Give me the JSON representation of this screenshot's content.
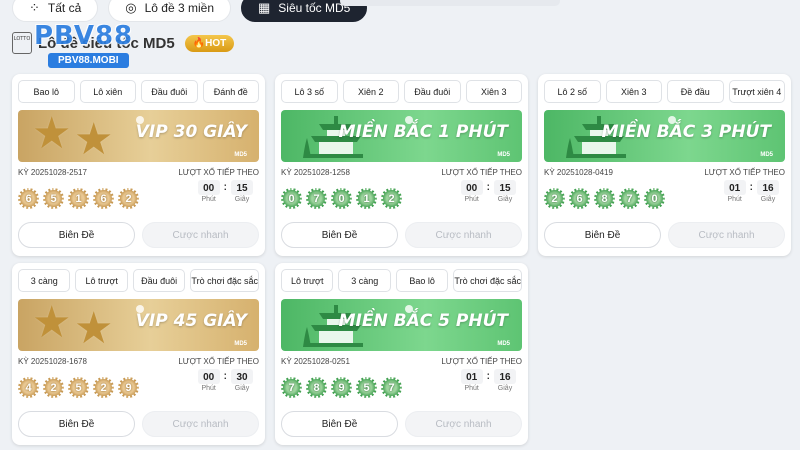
{
  "tabs": [
    {
      "label": "Tất cả",
      "icon": "grid-icon"
    },
    {
      "label": "Lô đề 3 miền",
      "icon": "lottery-ball-icon"
    },
    {
      "label": "Siêu tốc MD5",
      "icon": "calculator-icon"
    }
  ],
  "header": {
    "icon_text": "LOTTO",
    "title": "Lô đề siêu tốc MD5",
    "hot_label": "🔥HOT"
  },
  "logo": {
    "brand": "PBV88",
    "domain": "PBV88.MOBI"
  },
  "labels": {
    "next_draw": "LƯỢT XỔ TIẾP THEO",
    "minute": "Phút",
    "second": "Giây",
    "sub_tag": "MD5"
  },
  "colors": {
    "gold_banner": "#d6b16e",
    "green_banner": "#5ec473",
    "active_tab": "#1e2430"
  },
  "cards": [
    {
      "theme": "gold",
      "pills": [
        "Bao lô",
        "Lô xiên",
        "Đầu đuôi",
        "Đánh đề"
      ],
      "banner_text": "VIP 30 GIÂY",
      "period": "KỲ 20251028-2517",
      "results": [
        "6",
        "5",
        "1",
        "6",
        "2"
      ],
      "minutes": "00",
      "seconds": "15",
      "btn_primary": "Biên Đề",
      "btn_secondary": "Cược nhanh"
    },
    {
      "theme": "green",
      "pills": [
        "Lô 3 số",
        "Xiên 2",
        "Đầu đuôi",
        "Xiên 3"
      ],
      "banner_text": "MIỀN BẮC 1 PHÚT",
      "period": "KỲ 20251028-1258",
      "results": [
        "0",
        "7",
        "0",
        "1",
        "2"
      ],
      "minutes": "00",
      "seconds": "15",
      "btn_primary": "Biên Đề",
      "btn_secondary": "Cược nhanh"
    },
    {
      "theme": "green",
      "pills": [
        "Lô 2 số",
        "Xiên 3",
        "Đề đầu",
        "Trượt xiên 4"
      ],
      "banner_text": "MIỀN BẮC 3 PHÚT",
      "period": "KỲ 20251028-0419",
      "results": [
        "2",
        "6",
        "8",
        "7",
        "0"
      ],
      "minutes": "01",
      "seconds": "16",
      "btn_primary": "Biên Đề",
      "btn_secondary": "Cược nhanh"
    },
    {
      "theme": "gold",
      "pills": [
        "3 càng",
        "Lô trượt",
        "Đầu đuôi",
        "Trò chơi đặc sắc"
      ],
      "banner_text": "VIP 45 GIÂY",
      "period": "KỲ 20251028-1678",
      "results": [
        "4",
        "2",
        "5",
        "2",
        "9"
      ],
      "minutes": "00",
      "seconds": "30",
      "btn_primary": "Biên Đề",
      "btn_secondary": "Cược nhanh"
    },
    {
      "theme": "green",
      "pills": [
        "Lô trượt",
        "3 càng",
        "Bao lô",
        "Trò chơi đặc sắc"
      ],
      "banner_text": "MIỀN BẮC 5 PHÚT",
      "period": "KỲ 20251028-0251",
      "results": [
        "7",
        "8",
        "9",
        "5",
        "7"
      ],
      "minutes": "01",
      "seconds": "16",
      "btn_primary": "Biên Đề",
      "btn_secondary": "Cược nhanh"
    }
  ]
}
